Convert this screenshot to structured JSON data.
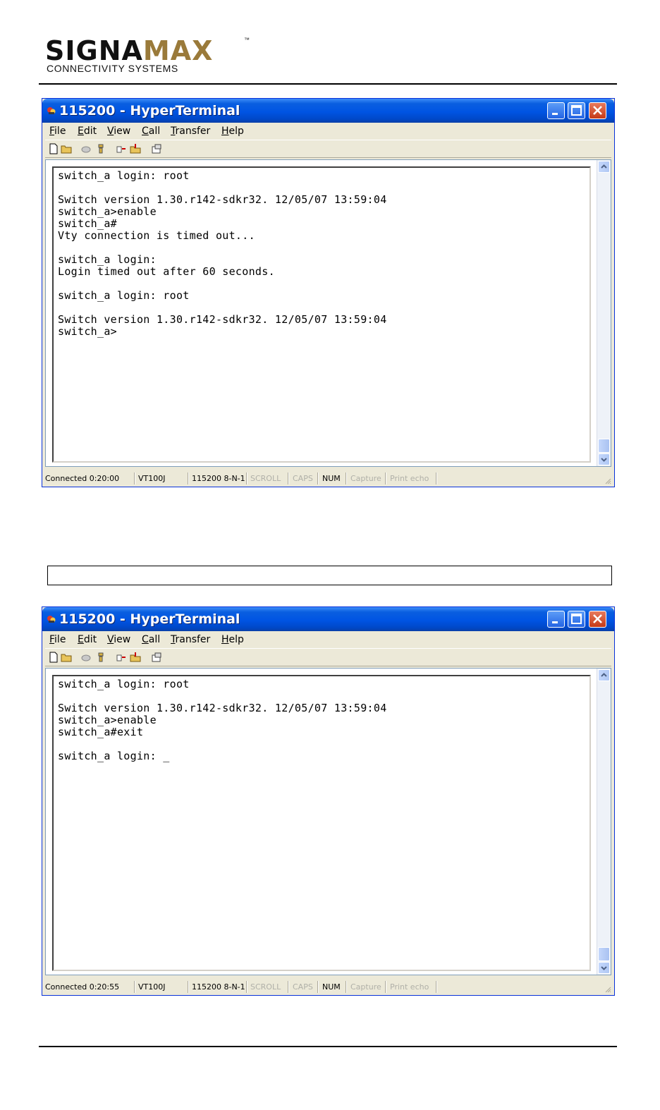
{
  "logo": {
    "part1": "SIGNA",
    "part2": "MAX",
    "tm": "™",
    "subtitle": "CONNECTIVITY SYSTEMS"
  },
  "windows": [
    {
      "title": "115200 - HyperTerminal",
      "menu": [
        "File",
        "Edit",
        "View",
        "Call",
        "Transfer",
        "Help"
      ],
      "terminal": "switch_a login: root\n\nSwitch version 1.30.r142-sdkr32. 12/05/07 13:59:04\nswitch_a>enable\nswitch_a#\nVty connection is timed out...\n\nswitch_a login:\nLogin timed out after 60 seconds.\n\nswitch_a login: root\n\nSwitch version 1.30.r142-sdkr32. 12/05/07 13:59:04\nswitch_a>",
      "status": {
        "connected": "Connected 0:20:00",
        "emulation": "VT100J",
        "settings": "115200 8-N-1",
        "scroll": "SCROLL",
        "caps": "CAPS",
        "num": "NUM",
        "capture": "Capture",
        "print_echo": "Print echo"
      }
    },
    {
      "title": "115200 - HyperTerminal",
      "menu": [
        "File",
        "Edit",
        "View",
        "Call",
        "Transfer",
        "Help"
      ],
      "terminal": "switch_a login: root\n\nSwitch version 1.30.r142-sdkr32. 12/05/07 13:59:04\nswitch_a>enable\nswitch_a#exit\n\nswitch_a login: _",
      "status": {
        "connected": "Connected 0:20:55",
        "emulation": "VT100J",
        "settings": "115200 8-N-1",
        "scroll": "SCROLL",
        "caps": "CAPS",
        "num": "NUM",
        "capture": "Capture",
        "print_echo": "Print echo"
      }
    }
  ],
  "icons": [
    "app-icon",
    "minimize-icon",
    "maximize-icon",
    "close-icon",
    "new-icon",
    "open-icon",
    "disconnect-icon",
    "dial-icon",
    "send-icon",
    "receive-icon",
    "properties-icon"
  ],
  "colors": {
    "titlebar": "#0054e3",
    "close": "#c63a17",
    "logo_accent": "#9a7a3a"
  }
}
